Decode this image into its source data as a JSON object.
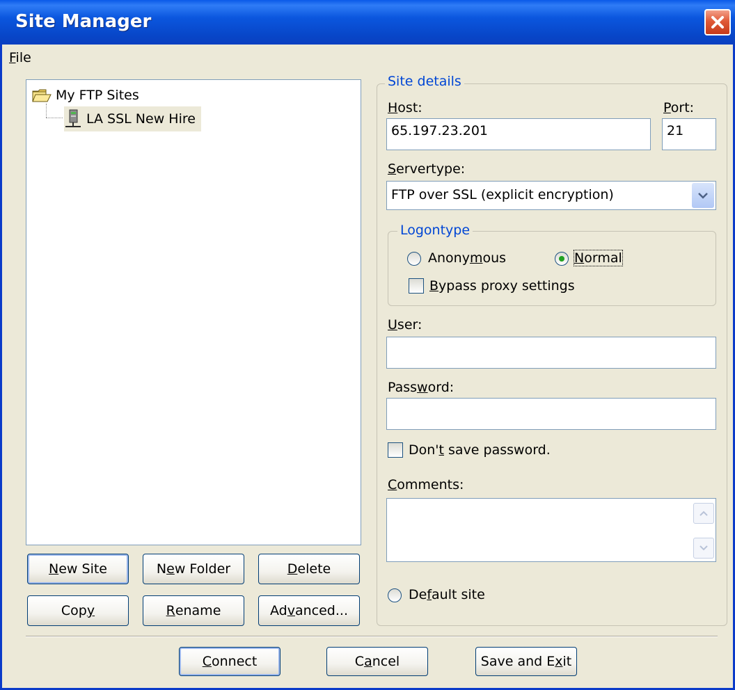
{
  "window": {
    "title": "Site Manager"
  },
  "menu": {
    "file": "File"
  },
  "tree": {
    "root_label": "My FTP Sites",
    "child_label": "LA SSL New Hire",
    "icons": {
      "root": "folder-icon",
      "child": "server-icon"
    }
  },
  "left_buttons": {
    "new_site": "New Site",
    "new_folder": "New Folder",
    "delete": "Delete",
    "copy": "Copy",
    "rename": "Rename",
    "advanced": "Advanced..."
  },
  "site_details": {
    "legend": "Site details",
    "host_label": "Host:",
    "host_value": "65.197.23.201",
    "port_label": "Port:",
    "port_value": "21",
    "servertype_label": "Servertype:",
    "servertype_value": "FTP over SSL (explicit encryption)",
    "logontype": {
      "legend": "Logontype",
      "anonymous": "Anonymous",
      "normal": "Normal",
      "selected": "Normal",
      "bypass_proxy": "Bypass proxy settings",
      "bypass_checked": false
    },
    "user_label": "User:",
    "user_value": "",
    "password_label": "Password:",
    "password_value": "",
    "dont_save_password": "Don't save password.",
    "dont_save_checked": false,
    "comments_label": "Comments:",
    "comments_value": "",
    "default_site": "Default site",
    "default_selected": false
  },
  "bottom_buttons": {
    "connect": "Connect",
    "cancel": "Cancel",
    "save_exit": "Save and Exit"
  },
  "colors": {
    "titlebar": "#0a5ae8",
    "accent_legend": "#0046d5",
    "dialog_bg": "#ece9d8",
    "radio_selected": "#21a121"
  }
}
